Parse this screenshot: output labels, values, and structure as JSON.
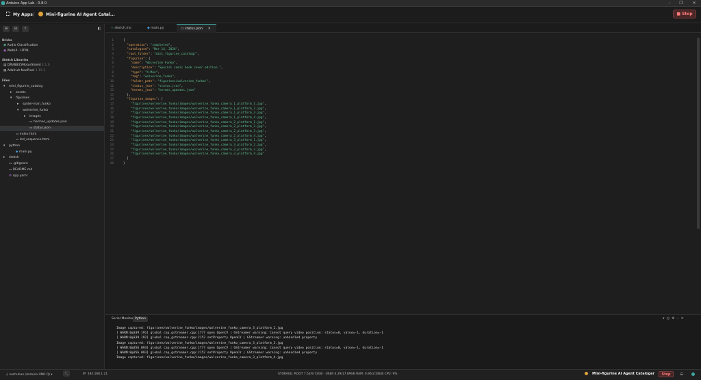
{
  "window": {
    "title": "Arduino App Lab - 0.8.0"
  },
  "header": {
    "my_apps": "My Apps",
    "separator": "/",
    "app_name": "Mini-figurine AI Agent Catal...",
    "stop_label": "Stop"
  },
  "sidebar": {
    "bricks_title": "Bricks",
    "bricks": [
      "Audio Classification",
      "WebUI - HTML"
    ],
    "libraries_title": "Sketch Libraries",
    "libraries": [
      {
        "name": "DRV8835MotorShield",
        "version": "2.1.0"
      },
      {
        "name": "Adafruit NeoPixel",
        "version": "1.15.3"
      }
    ],
    "files_title": "Files",
    "files": [
      {
        "label": "mini_figurine_catalog",
        "arrow": "▾"
      },
      {
        "label": "assets",
        "arrow": "▸"
      },
      {
        "label": "figurines",
        "arrow": "▾"
      },
      {
        "label": "spider-man_funko",
        "arrow": "▸"
      },
      {
        "label": "wolverine_funko",
        "arrow": "▾"
      },
      {
        "label": "images",
        "arrow": "▸"
      },
      {
        "label": "hermes_updates.json",
        "arrow": ""
      },
      {
        "label": "status.json",
        "arrow": ""
      },
      {
        "label": "index.html",
        "arrow": ""
      },
      {
        "label": "led_sequence.html",
        "arrow": ""
      },
      {
        "label": "python",
        "arrow": "▾"
      },
      {
        "label": "main.py",
        "arrow": ""
      },
      {
        "label": "sketch",
        "arrow": "▸"
      },
      {
        "label": ".gitignore",
        "arrow": ""
      },
      {
        "label": "README.md",
        "arrow": ""
      },
      {
        "label": "app.yaml",
        "arrow": ""
      }
    ]
  },
  "tabs": [
    {
      "label": "sketch.ino"
    },
    {
      "label": "main.py"
    },
    {
      "label": "status.json",
      "close": "×"
    }
  ],
  "code_lines": [
    "{",
    "  \"operation\": \"completed\",",
    "  \"catalogued\": \"Mar 14, 2026\",",
    "  \"root_folder\": \"mini_figurine_catalog/\",",
    "  \"figurine\": {",
    "    \"name\": \"Wolverine Funko\",",
    "    \"description\": \"Special comic book cover edition.\",",
    "    \"type\": \"X-Men\",",
    "    \"tag\": \"wolverine_funko\",",
    "    \"folder_path\": \"figurines/wolverine_funko/\",",
    "    \"status_json\": \"status.json\",",
    "    \"hermes_json\": \"hermes_updates.json\"",
    "  },",
    "  \"figurine_images\": [",
    "    \"figurines/wolverine_funko/images/wolverine_funko_camera_1_platform_1.jpg\",",
    "    \"figurines/wolverine_funko/images/wolverine_funko_camera_1_platform_2.jpg\",",
    "    \"figurines/wolverine_funko/images/wolverine_funko_camera_1_platform_3.jpg\",",
    "    \"figurines/wolverine_funko/images/wolverine_funko_camera_1_platform_4.jpg\",",
    "    \"figurines/wolverine_funko/images/wolverine_funko_camera_2_platform_1.jpg\",",
    "    \"figurines/wolverine_funko/images/wolverine_funko_camera_2_platform_2.jpg\",",
    "    \"figurines/wolverine_funko/images/wolverine_funko_camera_2_platform_3.jpg\",",
    "    \"figurines/wolverine_funko/images/wolverine_funko_camera_2_platform_4.jpg\",",
    "    \"figurines/wolverine_funko/images/wolverine_funko_camera_3_platform_1.jpg\",",
    "    \"figurines/wolverine_funko/images/wolverine_funko_camera_3_platform_2.jpg\",",
    "    \"figurines/wolverine_funko/images/wolverine_funko_camera_3_platform_3.jpg\",",
    "    \"figurines/wolverine_funko/images/wolverine_funko_camera_3_platform_4.jpg\"",
    "  ]",
    "}"
  ],
  "panel": {
    "tabs": [
      "Serial Monitor",
      "Python"
    ],
    "lines": [
      "Image captured: figurines/wolverine_funko/images/wolverine_funko_camera_3_platform_2.jpg",
      "[ WARN:0@339.191] global cap_gstreamer.cpp:1777 open OpenCV | GStreamer warning: Cannot query video position: status=0, value=-1, duration=-1",
      "[ WARN:0@339.192] global cap_gstreamer.cpp:2152 setProperty OpenCV | GStreamer warning: unhandled property",
      "Image captured: figurines/wolverine_funko/images/wolverine_funko_camera_3_platform_3.jpg",
      "[ WARN:0@356.093] global cap_gstreamer.cpp:1777 open OpenCV | GStreamer warning: Cannot query video position: status=0, value=-1, duration=-1",
      "[ WARN:0@356.093] global cap_gstreamer.cpp:2152 setProperty OpenCV | GStreamer warning: unhandled property",
      "Image captured: figurines/wolverine_funko/images/wolverine_funko_camera_3_platform_4.jpg"
    ]
  },
  "status": {
    "board": "kozhuhan (Arduino UNO Q)",
    "ip": "IP: 192.168.1.21",
    "storage": "STORAGE: ROOT 7.53/9.72GB · USER 4.29/17.89GB   RAM: 0.96/3.58GB   CPU: 9%",
    "app_name": "Mini-figurine AI Agent Cataloger",
    "stop_label": "Stop"
  },
  "colors": {
    "accent": "#3fa9a0",
    "stop": "#ff7b7b",
    "key": "#e6a157",
    "string": "#5fc090"
  }
}
